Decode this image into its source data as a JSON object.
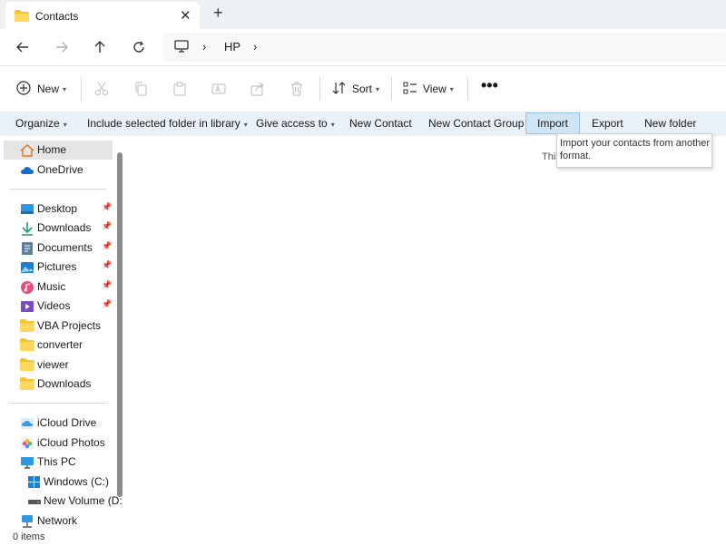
{
  "tab": {
    "title": "Contacts",
    "close_icon": "close-icon",
    "new_tab_icon": "plus-icon"
  },
  "nav": {
    "back_icon": "arrow-left-icon",
    "forward_icon": "arrow-right-icon",
    "up_icon": "arrow-up-icon",
    "refresh_icon": "refresh-icon",
    "breadcrumb": [
      "HP"
    ]
  },
  "toolbar": {
    "new_label": "New",
    "sort_label": "Sort",
    "view_label": "View"
  },
  "commands": {
    "organize": "Organize",
    "include": "Include selected folder in library",
    "give_access": "Give access to",
    "new_contact": "New Contact",
    "new_contact_group": "New Contact Group",
    "import": "Import",
    "export": "Export",
    "new_folder": "New folder"
  },
  "tooltip": {
    "text": "Import your contacts from another format."
  },
  "content": {
    "empty_text": "This"
  },
  "sidebar": {
    "items": [
      {
        "label": "Home",
        "icon": "home-icon"
      },
      {
        "label": "OneDrive",
        "icon": "cloud-icon"
      },
      {
        "label": "Desktop",
        "icon": "desktop-icon",
        "pinned": true
      },
      {
        "label": "Downloads",
        "icon": "download-icon",
        "pinned": true
      },
      {
        "label": "Documents",
        "icon": "documents-icon",
        "pinned": true
      },
      {
        "label": "Pictures",
        "icon": "pictures-icon",
        "pinned": true
      },
      {
        "label": "Music",
        "icon": "music-icon",
        "pinned": true
      },
      {
        "label": "Videos",
        "icon": "videos-icon",
        "pinned": true
      },
      {
        "label": "VBA Projects",
        "icon": "folder-icon"
      },
      {
        "label": "converter",
        "icon": "folder-icon"
      },
      {
        "label": "viewer",
        "icon": "folder-icon"
      },
      {
        "label": "Downloads",
        "icon": "folder-icon"
      },
      {
        "label": "iCloud Drive",
        "icon": "icloud-icon"
      },
      {
        "label": "iCloud Photos",
        "icon": "icloud-photos-icon"
      },
      {
        "label": "This PC",
        "icon": "computer-icon"
      },
      {
        "label": "Windows (C:)",
        "icon": "drive-icon"
      },
      {
        "label": "New Volume (D:",
        "icon": "drive-icon"
      },
      {
        "label": "Network",
        "icon": "network-icon"
      }
    ]
  },
  "status": {
    "items_count": "0 items"
  },
  "colors": {
    "accent": "#0067c0",
    "folder": "#f4c430",
    "selected_cmd": "#cfe4f5",
    "cmdbar_bg": "#eaf1f7"
  }
}
